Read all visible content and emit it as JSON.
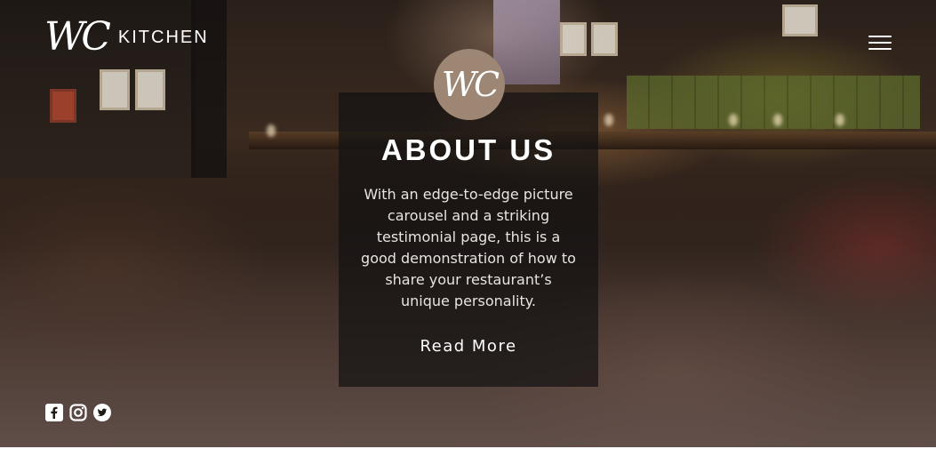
{
  "header": {
    "logo_mark": "WC",
    "logo_text": "KITCHEN",
    "menu_icon": "hamburger-menu-icon"
  },
  "about": {
    "badge_text": "WC",
    "title": "ABOUT US",
    "body": "With an edge-to-edge picture carousel and a striking testimonial page, this is a good demonstration of how to share your restaurant’s unique personality.",
    "cta_label": "Read More"
  },
  "social": {
    "icons": [
      "facebook-icon",
      "instagram-icon",
      "twitter-icon"
    ]
  },
  "colors": {
    "badge": "#9d8674",
    "card_overlay": "#141212",
    "text": "#ffffff"
  }
}
